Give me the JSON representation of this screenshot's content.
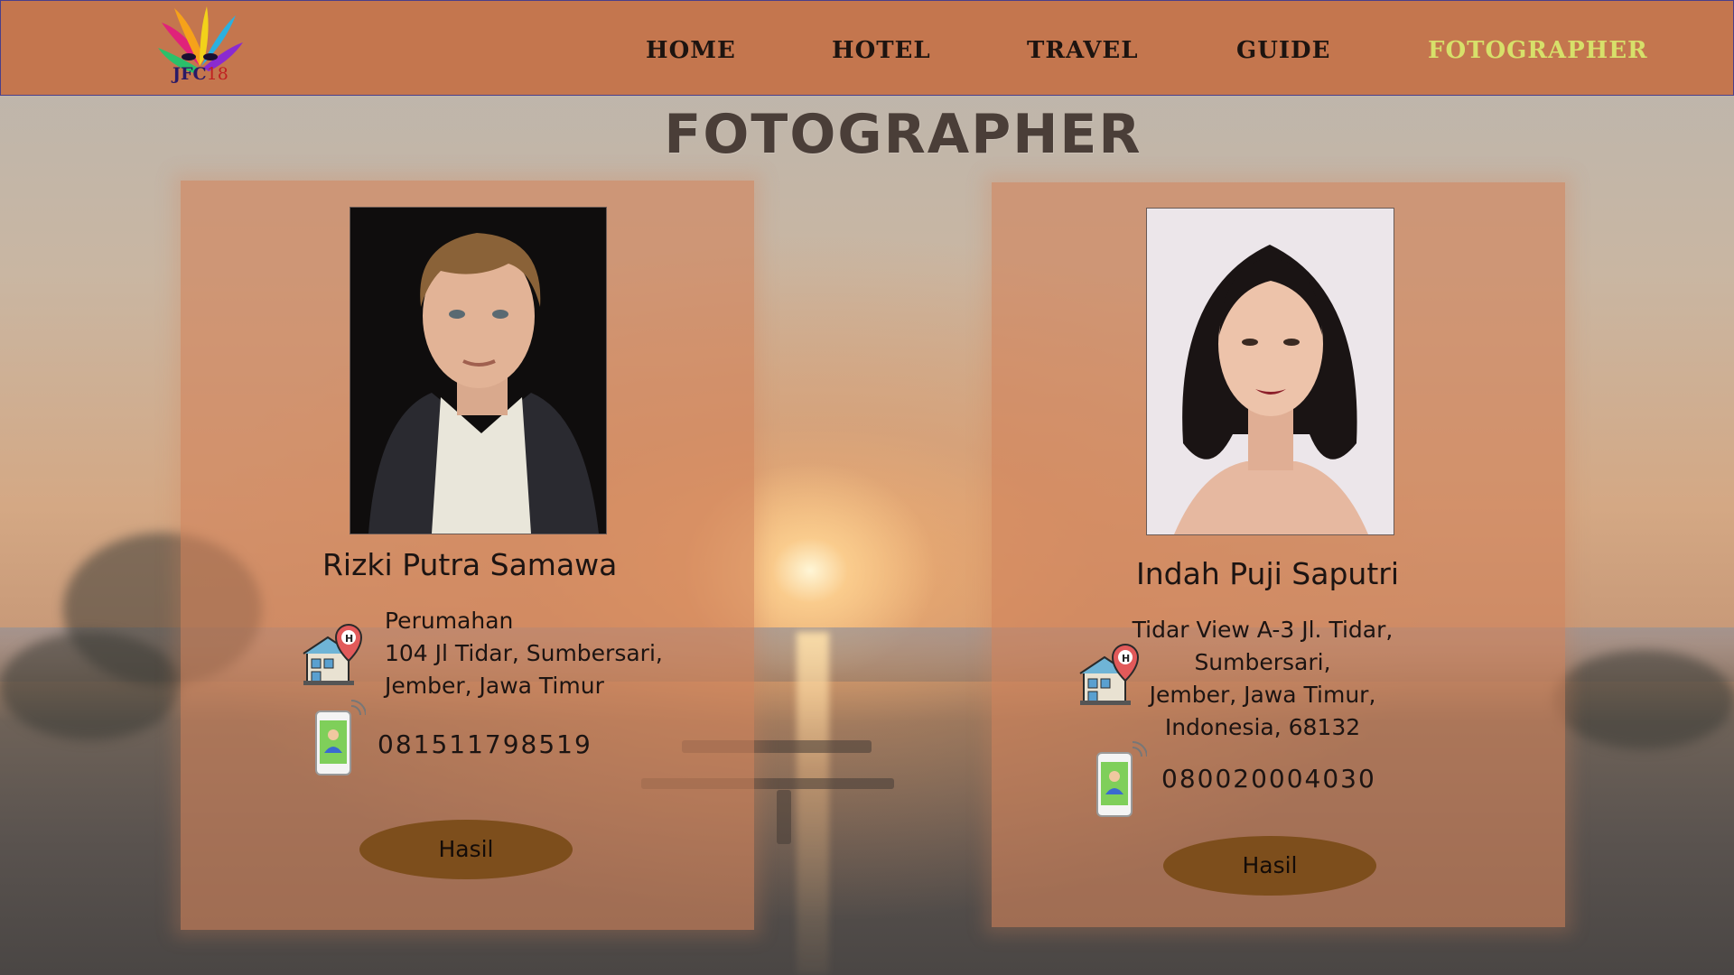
{
  "logo": {
    "text_main": "JFC",
    "text_num": "18"
  },
  "nav": [
    {
      "label": "HOME"
    },
    {
      "label": "HOTEL"
    },
    {
      "label": "TRAVEL"
    },
    {
      "label": "GUIDE"
    },
    {
      "label": "FOTOGRAPHER",
      "active": true
    }
  ],
  "page_title": "FOTOGRAPHER",
  "photographers": [
    {
      "name": "Rizki Putra Samawa",
      "address_lines": [
        "Perumahan",
        "104 Jl Tidar, Sumbersari,",
        "Jember, Jawa Timur"
      ],
      "phone": "081511798519",
      "button_label": "Hasil"
    },
    {
      "name": "Indah Puji Saputri",
      "address_lines": [
        "Tidar View A-3 Jl. Tidar,",
        "Sumbersari,",
        "Jember, Jawa Timur,",
        "Indonesia, 68132"
      ],
      "phone": "080020004030",
      "button_label": "Hasil"
    }
  ],
  "colors": {
    "header_bg": "#c4764e",
    "nav_active": "#d7e06a",
    "card_bg": "#d2825a",
    "button_bg": "#7d4e1c"
  },
  "icons": [
    "hotel-location-icon",
    "smartphone-contact-icon"
  ]
}
